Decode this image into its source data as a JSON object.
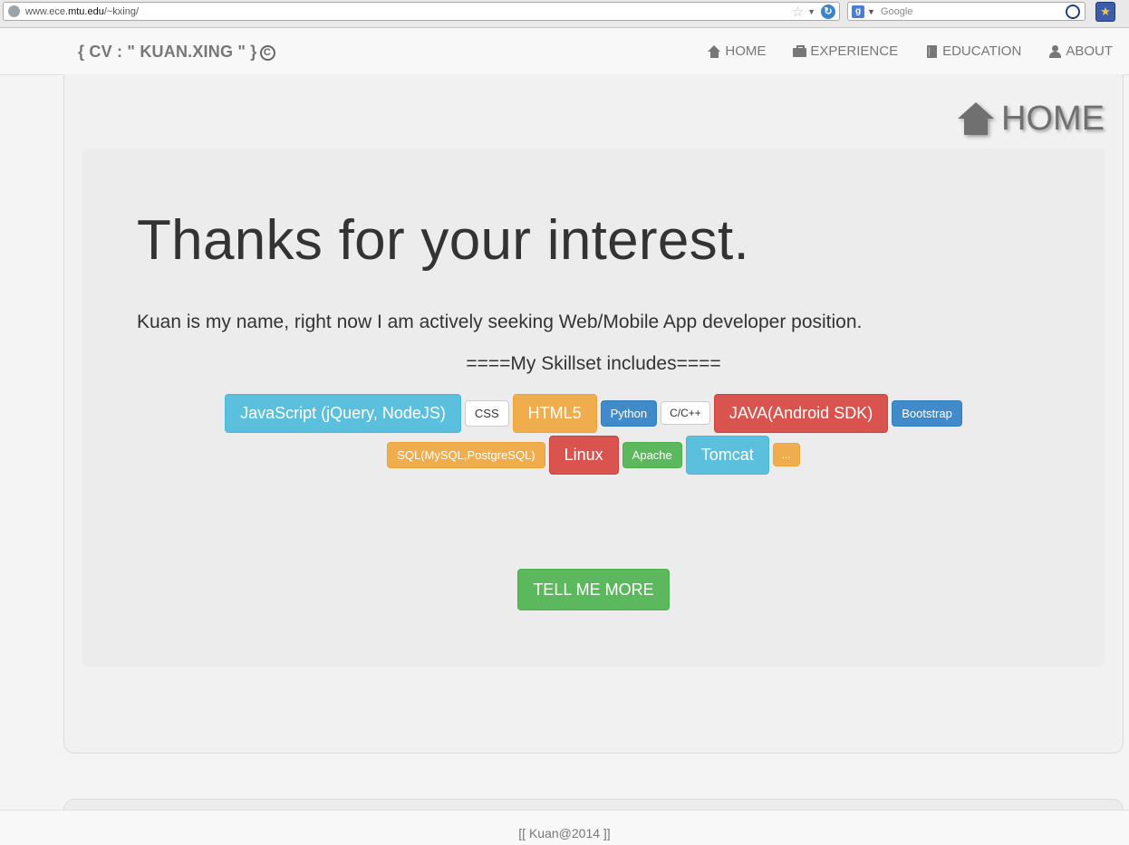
{
  "browser": {
    "url_prefix": "www.ece.",
    "url_domain": "mtu.edu",
    "url_path": "/~kxing/",
    "search_placeholder": "Google",
    "search_engine_letter": "g"
  },
  "navbar": {
    "brand": "{ CV : \" KUAN.XING \" }",
    "brand_symbol": "C",
    "links": [
      {
        "label": "HOME",
        "icon": "home-icon"
      },
      {
        "label": "EXPERIENCE",
        "icon": "briefcase-icon"
      },
      {
        "label": "EDUCATION",
        "icon": "book-icon"
      },
      {
        "label": "ABOUT",
        "icon": "user-icon"
      }
    ]
  },
  "main": {
    "section_heading": "HOME",
    "headline": "Thanks for your interest.",
    "lead": "Kuan is my name, right now I am actively seeking Web/Mobile App developer position.",
    "skill_title": "====My Skillset includes====",
    "skills_row1": [
      {
        "label": "JavaScript (jQuery, NodeJS)",
        "style": "info",
        "size": "lg"
      },
      {
        "label": "CSS",
        "style": "default",
        "size": "sm"
      },
      {
        "label": "HTML5",
        "style": "warning",
        "size": "lg"
      },
      {
        "label": "Python",
        "style": "primary",
        "size": "sm"
      },
      {
        "label": "C/C++",
        "style": "default",
        "size": "xs"
      },
      {
        "label": "JAVA(Android SDK)",
        "style": "danger",
        "size": "lg"
      },
      {
        "label": "Bootstrap",
        "style": "primary",
        "size": "sm"
      }
    ],
    "skills_row2": [
      {
        "label": "SQL(MySQL,PostgreSQL)",
        "style": "warning",
        "size": "sm"
      },
      {
        "label": "Linux",
        "style": "danger",
        "size": "lg"
      },
      {
        "label": "Apache",
        "style": "success",
        "size": "sm"
      },
      {
        "label": "Tomcat",
        "style": "info",
        "size": "lg"
      },
      {
        "label": "...",
        "style": "warning",
        "size": "xs"
      }
    ],
    "cta": "TELL ME MORE"
  },
  "footer": {
    "text": "[[ Kuan@2014 ]]"
  },
  "colors": {
    "info": "#5bc0de",
    "warning": "#f0ad4e",
    "primary": "#428bca",
    "danger": "#d9534f",
    "success": "#5cb85c",
    "default": "#ffffff"
  }
}
